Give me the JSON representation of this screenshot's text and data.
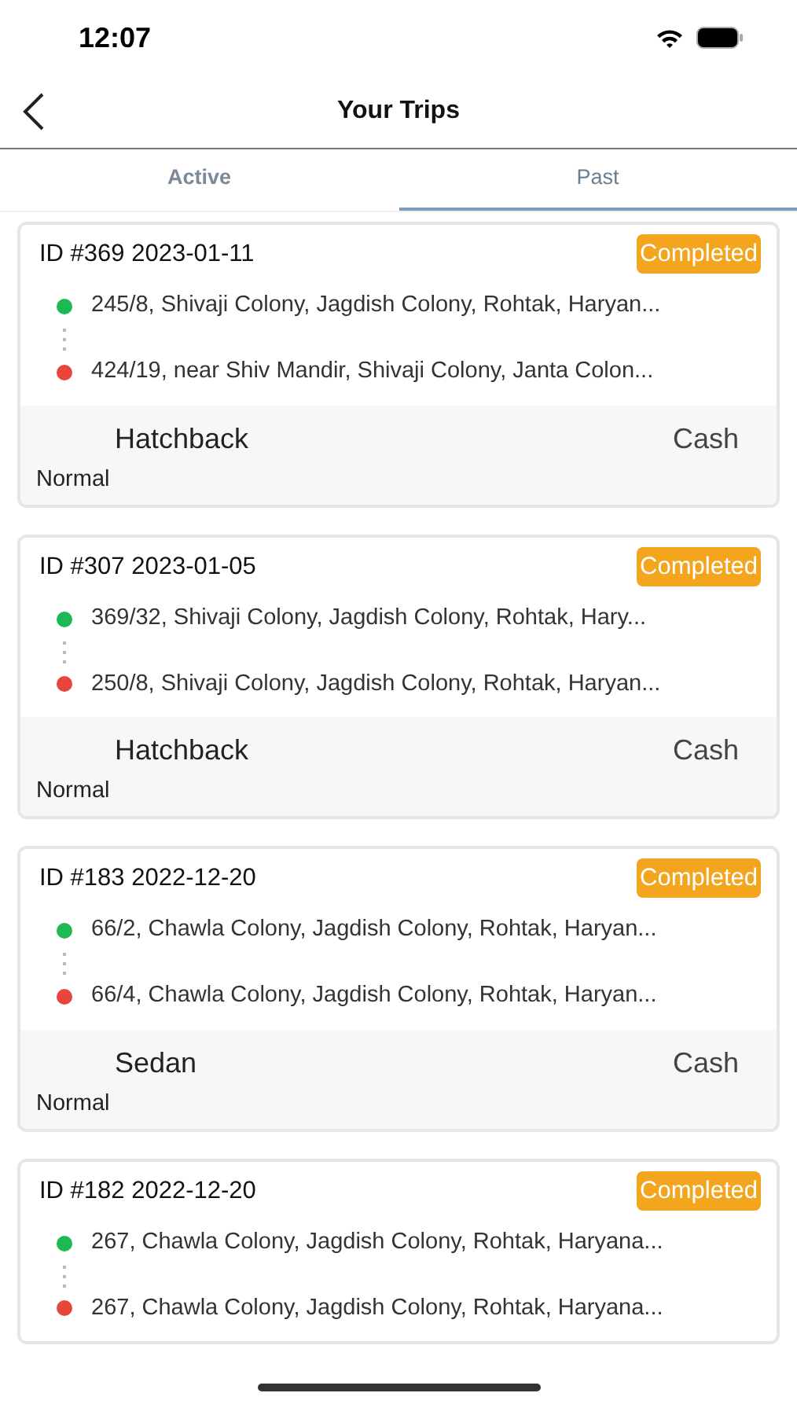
{
  "status_bar": {
    "time": "12:07"
  },
  "header": {
    "title": "Your Trips"
  },
  "tabs": [
    {
      "label": "Active",
      "selected": false
    },
    {
      "label": "Past",
      "selected": true
    }
  ],
  "trips": [
    {
      "title": "ID #369 2023-01-11",
      "status": "Completed",
      "pickup": "245/8, Shivaji Colony, Jagdish Colony, Rohtak, Haryan...",
      "drop": "424/19, near Shiv Mandir, Shivaji Colony, Janta Colon...",
      "vehicle": "Hatchback",
      "payment": "Cash",
      "ride_type": "Normal"
    },
    {
      "title": "ID #307 2023-01-05",
      "status": "Completed",
      "pickup": "369/32, Shivaji Colony, Jagdish Colony, Rohtak, Hary...",
      "drop": "250/8, Shivaji Colony, Jagdish Colony, Rohtak, Haryan...",
      "vehicle": "Hatchback",
      "payment": "Cash",
      "ride_type": "Normal"
    },
    {
      "title": "ID #183 2022-12-20",
      "status": "Completed",
      "pickup": "66/2, Chawla Colony, Jagdish Colony, Rohtak, Haryan...",
      "drop": "66/4, Chawla Colony, Jagdish Colony, Rohtak, Haryan...",
      "vehicle": "Sedan",
      "payment": "Cash",
      "ride_type": "Normal"
    },
    {
      "title": "ID #182 2022-12-20",
      "status": "Completed",
      "pickup": "267, Chawla Colony, Jagdish Colony, Rohtak, Haryana...",
      "drop": "267, Chawla Colony, Jagdish Colony, Rohtak, Haryana..."
    }
  ]
}
